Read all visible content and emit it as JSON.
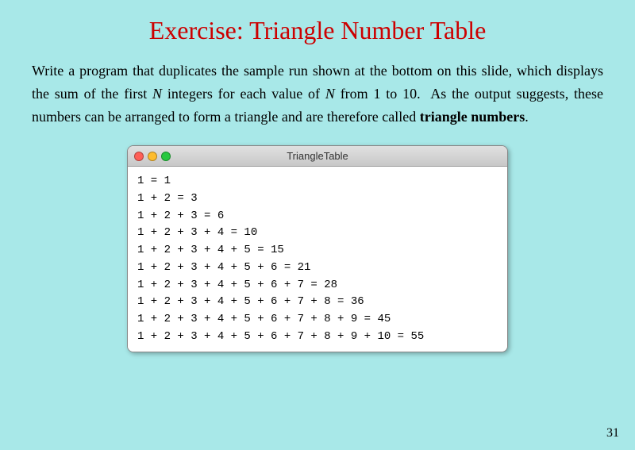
{
  "slide": {
    "title": "Exercise: Triangle Number Table",
    "body_lines": [
      "Write a program that duplicates the sample run shown at the bottom on this slide, which displays the sum of the first ",
      "N",
      " integers for each value of ",
      "N",
      " from 1 to 10.  As the output suggests, these numbers can be arranged to form a triangle and are therefore called ",
      "triangle numbers",
      "."
    ],
    "paragraph": "Write a program that duplicates the sample run shown at the bottom on this slide, which displays the sum of the first N integers for each value of N from 1 to 10.  As the output suggests, these numbers can be arranged to form a triangle and are therefore called triangle numbers.",
    "window": {
      "title": "TriangleTable",
      "lines": [
        "1 = 1",
        "1 + 2 = 3",
        "1 + 2 + 3 = 6",
        "1 + 2 + 3 + 4 = 10",
        "1 + 2 + 3 + 4 + 5 = 15",
        "1 + 2 + 3 + 4 + 5 + 6 = 21",
        "1 + 2 + 3 + 4 + 5 + 6 + 7 = 28",
        "1 + 2 + 3 + 4 + 5 + 6 + 7 + 8 = 36",
        "1 + 2 + 3 + 4 + 5 + 6 + 7 + 8 + 9 = 45",
        "1 + 2 + 3 + 4 + 5 + 6 + 7 + 8 + 9 + 10 = 55"
      ]
    },
    "page_number": "31"
  }
}
